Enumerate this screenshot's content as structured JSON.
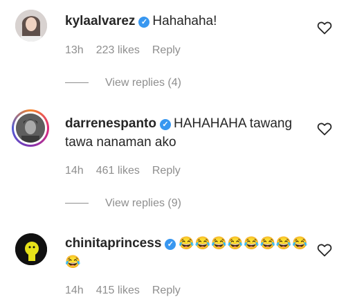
{
  "comments": [
    {
      "username": "kylaalvarez",
      "verified_mark": "✓",
      "text": "Hahahaha!",
      "time": "13h",
      "likes": "223 likes",
      "reply": "Reply",
      "view_replies": "View replies (4)"
    },
    {
      "username": "darrenespanto",
      "verified_mark": "✓",
      "text": "HAHAHAHA tawang tawa nanaman ako",
      "time": "14h",
      "likes": "461 likes",
      "reply": "Reply",
      "view_replies": "View replies (9)"
    },
    {
      "username": "chinitaprincess",
      "verified_mark": "✓",
      "text": "😂😂😂😂😂😂😂😂😂",
      "time": "14h",
      "likes": "415 likes",
      "reply": "Reply"
    }
  ],
  "colors": {
    "verified": "#3897f0",
    "meta": "#8e8e8e",
    "text": "#262626"
  },
  "icons": {
    "like": "heart-outline-icon",
    "verified": "verified-badge-icon"
  }
}
